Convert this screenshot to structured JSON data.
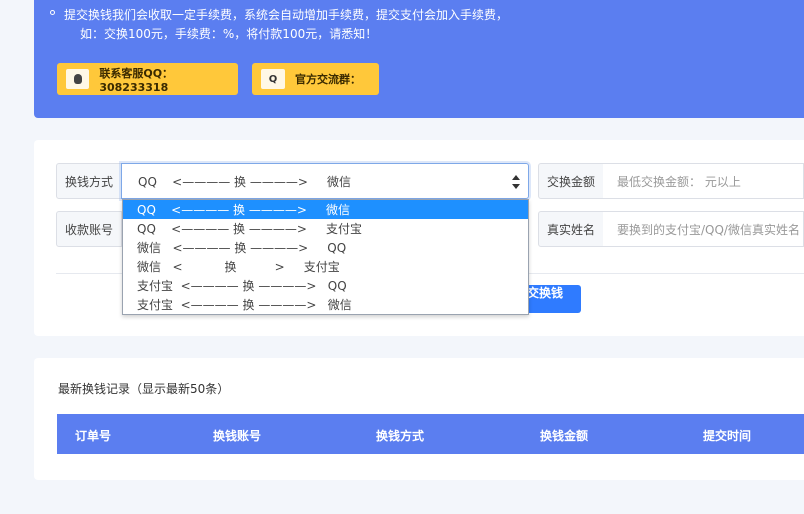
{
  "notice": {
    "line1": "提交换钱我们会收取一定手续费，系统会自动增加手续费，提交支付会加入手续费，",
    "line2": "如：交换100元，手续费：%，将付款100元，请悉知！"
  },
  "contact": {
    "qq_label": "联系客服QQ：308233318",
    "qq_icon": "penguin-icon",
    "group_label": "官方交流群：",
    "group_icon_text": "Q"
  },
  "form": {
    "method_label": "换钱方式",
    "account_label": "收款账号",
    "amount_label": "交换金额",
    "name_label": "真实姓名",
    "selected_method": "QQ    <———— 换 ————>     微信",
    "amount_placeholder": "最低交换金额： 元以上",
    "name_placeholder": "要换到的支付宝/QQ/微信真实姓名",
    "submit_label": "提交换钱~"
  },
  "dropdown": {
    "options": [
      "QQ    <———— 换 ————>     微信",
      "QQ    <———— 换 ————>     支付宝",
      "微信   <———— 换 ————>     QQ",
      "微信   <           换          >     支付宝",
      "支付宝  <———— 换 ————>   QQ",
      "支付宝  <———— 换 ————>   微信"
    ],
    "selected_index": 0
  },
  "records": {
    "title": "最新换钱记录（显示最新50条）",
    "columns": [
      "订单号",
      "换钱账号",
      "换钱方式",
      "换钱金额",
      "提交时间"
    ]
  },
  "colors": {
    "banner": "#5b7ef0",
    "yellow_button": "#ffc83a",
    "submit": "#2f7bff",
    "dropdown_selected": "#1e90ff"
  }
}
